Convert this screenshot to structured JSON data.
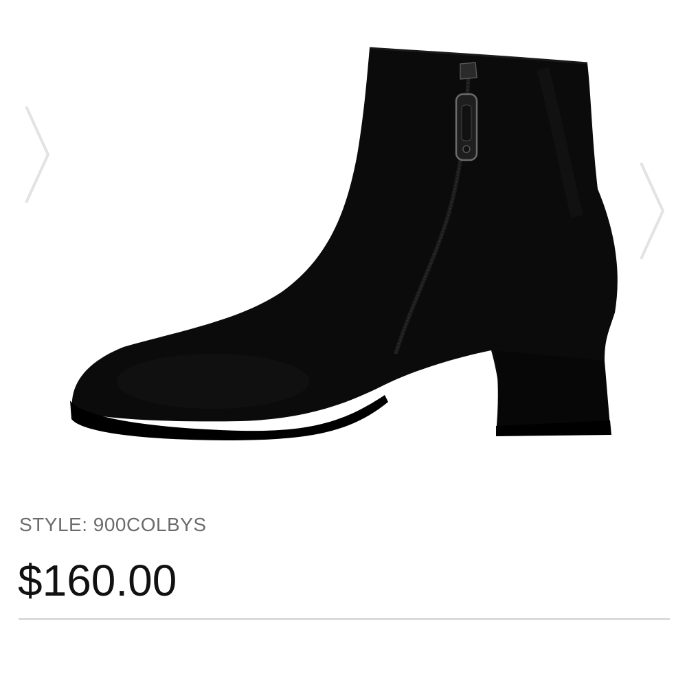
{
  "gallery": {
    "image_name": "black-suede-ankle-boot",
    "prev_icon": "chevron-left-icon",
    "next_icon": "chevron-right-icon"
  },
  "product": {
    "style_text": "STYLE: 900COLBYS",
    "price": "$160.00"
  },
  "colors": {
    "background": "#ffffff",
    "text_muted": "#6b6b6b",
    "text_primary": "#111111",
    "divider": "#cfcfcf",
    "arrow": "#e3e3e3",
    "boot": "#0b0b0b"
  }
}
